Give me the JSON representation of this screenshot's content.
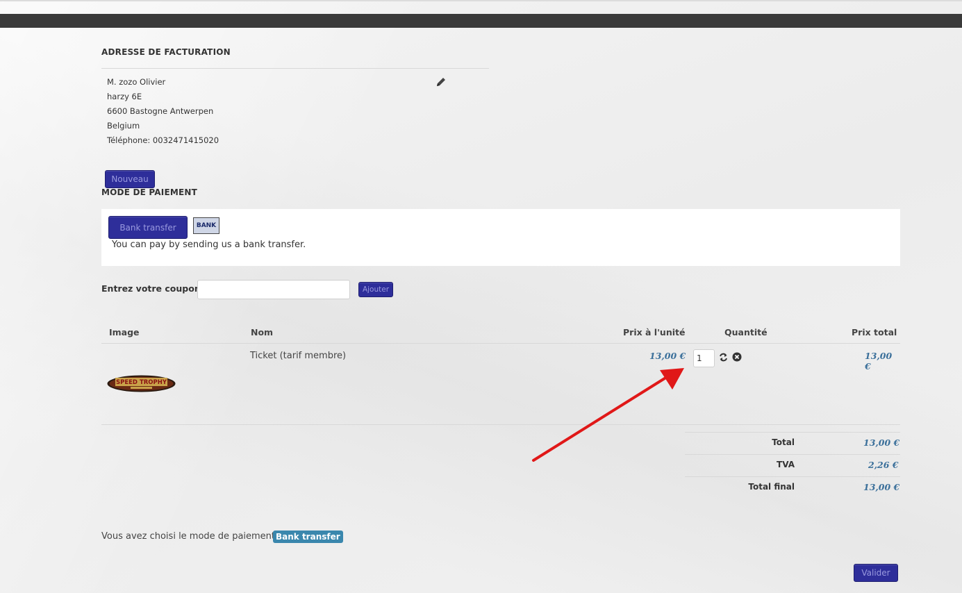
{
  "billing": {
    "title": "ADRESSE DE FACTURATION",
    "lines": [
      "M. zozo Olivier",
      "harzy 6E",
      "6600 Bastogne Antwerpen",
      "Belgium",
      "Téléphone: 0032471415020"
    ],
    "new_button": "Nouveau"
  },
  "payment": {
    "title": "MODE DE PAIEMENT",
    "method_button": "Bank transfer",
    "logo_text": "BANK",
    "description": "You can pay by sending us a bank transfer."
  },
  "coupon": {
    "label": "Entrez votre coupon",
    "input_value": "",
    "button": "Ajouter"
  },
  "cart": {
    "headers": {
      "image": "Image",
      "name": "Nom",
      "unit_price": "Prix à l'unité",
      "quantity": "Quantité",
      "total_price": "Prix total"
    },
    "items": [
      {
        "name": "Ticket (tarif membre)",
        "unit_price": "13,00 €",
        "quantity": "1",
        "total_price": "13,00 €",
        "logo_text": "SPEED TROPHY"
      }
    ],
    "summary": [
      {
        "label": "Total",
        "value": "13,00 €"
      },
      {
        "label": "TVA",
        "value": "2,26 €"
      },
      {
        "label": "Total final",
        "value": "13,00 €"
      }
    ]
  },
  "footer": {
    "chosen_text": "Vous avez choisi le mode de paiement:",
    "chosen_badge": "Bank transfer",
    "submit_button": "Valider"
  },
  "colors": {
    "accent_button": "#2e2e9a",
    "price_text": "#3a6f9a",
    "badge": "#3a87ad",
    "annotation_arrow": "#e01818"
  }
}
